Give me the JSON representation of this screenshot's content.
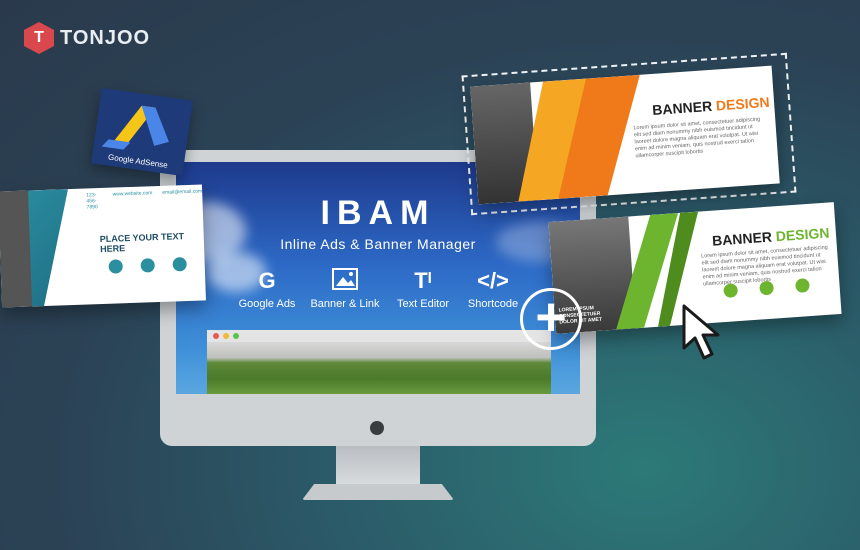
{
  "brand": {
    "logo_letter": "T",
    "name": "TONJOO"
  },
  "hero": {
    "title": "IBAM",
    "subtitle": "Inline Ads & Banner Manager",
    "features": [
      {
        "icon": "google-icon",
        "glyph": "G",
        "label": "Google Ads"
      },
      {
        "icon": "image-icon",
        "glyph": "▨",
        "label": "Banner & Link"
      },
      {
        "icon": "text-editor-icon",
        "glyph": "Tᴵ",
        "label": "Text Editor"
      },
      {
        "icon": "code-icon",
        "glyph": "</>",
        "label": "Shortcode"
      }
    ]
  },
  "adsense": {
    "label": "Google AdSense"
  },
  "card_left": {
    "headline": "PLACE YOUR TEXT HERE",
    "contact": "123-456-7890",
    "site": "www.website.com",
    "email": "email@email.com"
  },
  "card_top_right": {
    "title_part1": "BANNER ",
    "title_part2": "DESIGN",
    "body": "Lorem ipsum dolor sit amet, consectetuer adipiscing elit sed diam nonummy nibh euismod tincidunt ut laoreet dolore magna aliquam erat volutpat. Ut wisi enim ad minim veniam, quis nostrud exerci tation ullamcorper suscipit lobortis",
    "accent": "#f07a1a"
  },
  "card_bottom_right": {
    "title_part1": "BANNER ",
    "title_part2": "DESIGN",
    "body": "Lorem ipsum dolor sit amet, consectetuer adipiscing elit sed diam nonummy nibh euismod tincidunt ut laoreet dolore magna aliquam erat volutpat. Ut wisi enim ad minim veniam, quis nostrud exerci tation ullamcorper suscipit lobortis",
    "footer": "LOREM IPSUM CONSECTETUER DOLOR SIT AMET",
    "accent": "#6db52e"
  },
  "plus_glyph": "+",
  "colors": {
    "background": "#2b4255",
    "brand_red": "#d9484c",
    "screen_blue": "#2d6ac7",
    "orange": "#f07a1a",
    "green": "#6db52e",
    "teal": "#2b8fa0"
  }
}
